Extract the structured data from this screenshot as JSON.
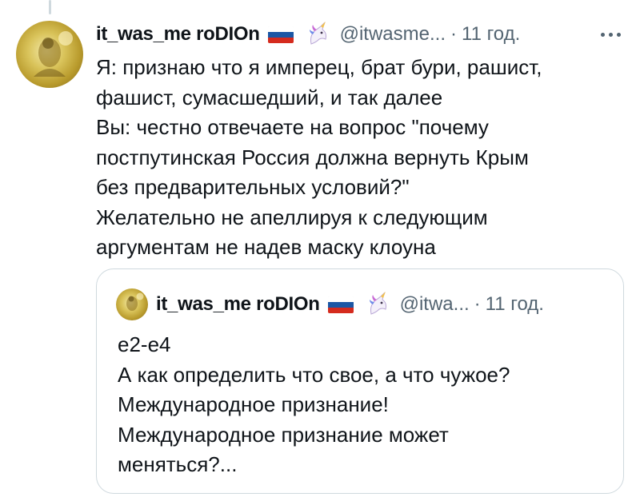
{
  "tweet": {
    "author": {
      "display_name": "it_was_me roDIOn",
      "flag_icon": "russia-flag-icon",
      "emoji_icon": "unicorn-icon",
      "handle": "@itwasme...",
      "time": "11 год."
    },
    "more_icon": "more-options-icon",
    "lines": [
      "Я: признаю что я имперец, брат бури, рашист,",
      "фашист, сумасшедший, и так далее",
      "Вы: честно отвечаете на вопрос \"почему",
      "постпутинская Россия должна вернуть Крым",
      "без предварительных условий?\"",
      "Желательно не апеллируя к следующим",
      "аргументам не надев маску клоуна"
    ]
  },
  "quoted": {
    "author": {
      "display_name": "it_was_me roDIOn",
      "flag_icon": "russia-flag-icon",
      "emoji_icon": "unicorn-icon",
      "handle": "@itwa...",
      "time": "11 год."
    },
    "lines": [
      "e2-e4",
      "А как определить что свое, а что чужое?",
      "Международное признание!",
      "Международное признание может",
      "меняться?..."
    ]
  },
  "colors": {
    "text": "#0f1419",
    "secondary": "#536471",
    "border": "#cfd9de",
    "flag_white": "#ffffff",
    "flag_blue": "#1c57a5",
    "flag_red": "#d52b1e"
  }
}
